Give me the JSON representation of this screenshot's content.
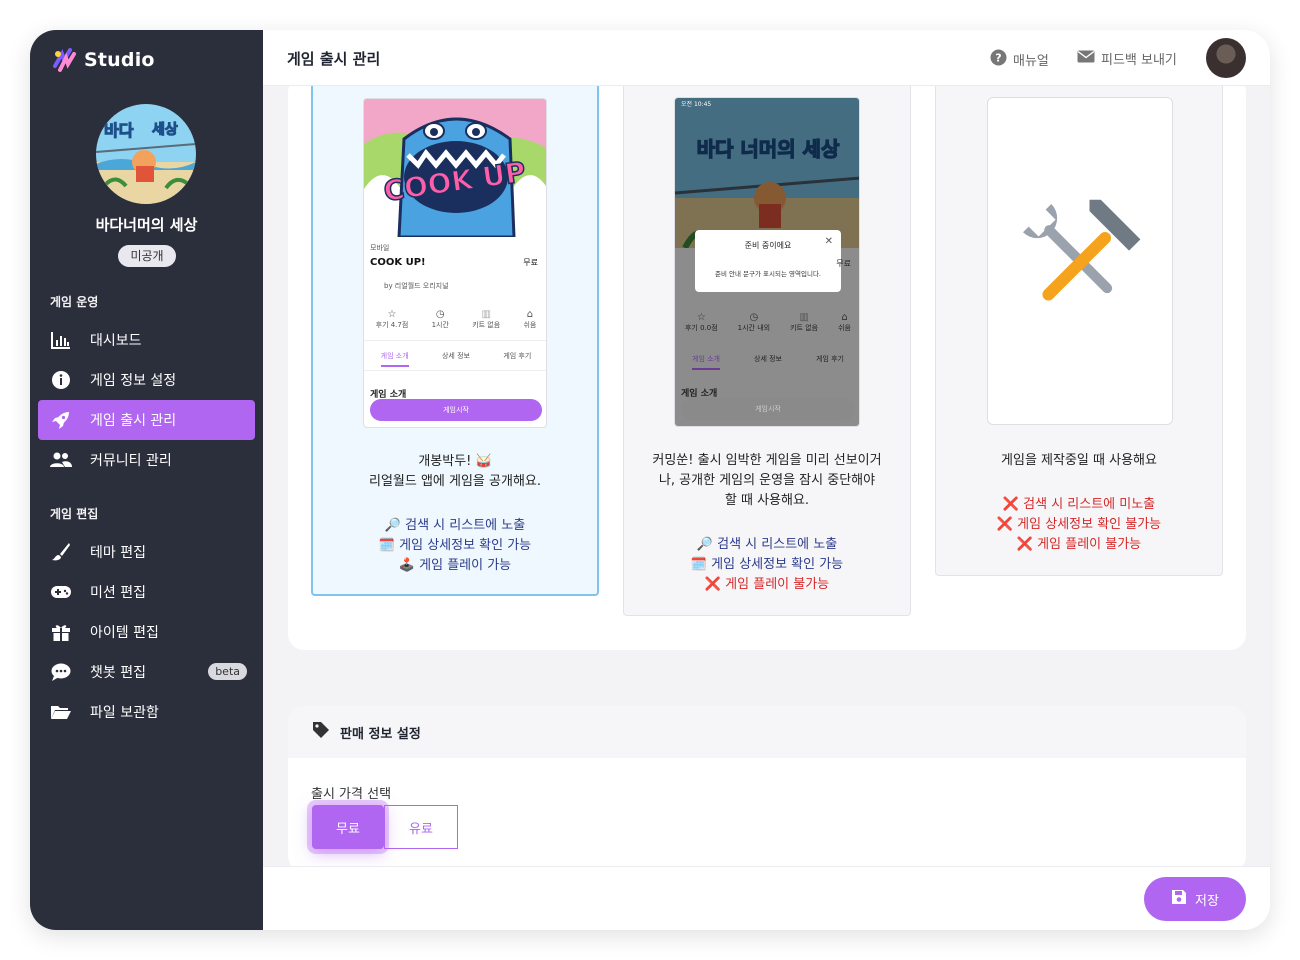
{
  "app": {
    "name": "Studio"
  },
  "sidebar": {
    "game_name": "바다너머의 세상",
    "status": "미공개",
    "sections": {
      "operation": "게임 운영",
      "editing": "게임 편집"
    },
    "items": [
      {
        "label": "대시보드",
        "icon": "bar-chart-icon"
      },
      {
        "label": "게임 정보 설정",
        "icon": "info-icon"
      },
      {
        "label": "게임 출시 관리",
        "icon": "rocket-icon",
        "active": true
      },
      {
        "label": "커뮤니티 관리",
        "icon": "users-icon"
      },
      {
        "label": "테마 편집",
        "icon": "brush-icon"
      },
      {
        "label": "미션 편집",
        "icon": "gamepad-icon"
      },
      {
        "label": "아이템 편집",
        "icon": "gift-icon"
      },
      {
        "label": "챗봇 편집",
        "icon": "chat-icon",
        "badge": "beta"
      },
      {
        "label": "파일 보관함",
        "icon": "folder-icon"
      }
    ]
  },
  "header": {
    "title": "게임 출시 관리",
    "manual": "매뉴얼",
    "feedback": "피드백 보내기"
  },
  "options": [
    {
      "phone": {
        "category": "모바일",
        "title": "COOK UP!",
        "price": "무료",
        "by": "by 리얼월드 오리지널",
        "stats": [
          "후기 4.7점",
          "1시간",
          "키트 없음",
          "쉬움"
        ],
        "tabs": [
          "게임 소개",
          "상세 정보",
          "게임 후기"
        ],
        "section": "게임 소개",
        "start": "게임시작",
        "cover_text": "COOK UP"
      },
      "desc": [
        "개봉박두! 🥁",
        "리얼월드 앱에 게임을 공개해요."
      ],
      "features": [
        {
          "text": "🔎 검색 시 리스트에 노출",
          "ok": true
        },
        {
          "text": "🗓️ 게임 상세정보 확인 가능",
          "ok": true
        },
        {
          "text": "🕹️ 게임 플레이 가능",
          "ok": true
        }
      ]
    },
    {
      "phone": {
        "statusbar": "오전 10:45",
        "modal_title": "준비 중이에요",
        "modal_body": "준비 안내 문구가 표시되는 영역입니다.",
        "price": "무료",
        "stats": [
          "후기 0.0점",
          "1시간 내외",
          "키트 없음",
          "쉬움"
        ],
        "tabs": [
          "게임 소개",
          "상세 정보",
          "게임 후기"
        ],
        "section": "게임 소개",
        "start": "게임시작",
        "cover_text": "바다 너머의 세상"
      },
      "desc": [
        "커밍쑨! 출시 임박한 게임을 미리 선보이거",
        "나, 공개한 게임의 운영을 잠시 중단해야",
        "할 때 사용해요."
      ],
      "features": [
        {
          "text": "🔎 검색 시 리스트에 노출",
          "ok": true
        },
        {
          "text": "🗓️ 게임 상세정보 확인 가능",
          "ok": true
        },
        {
          "text": "❌ 게임 플레이 불가능",
          "ok": false
        }
      ]
    },
    {
      "desc": [
        "게임을 제작중일 때 사용해요"
      ],
      "features": [
        {
          "text": "❌ 검색 시 리스트에 미노출",
          "ok": false
        },
        {
          "text": "❌ 게임 상세정보 확인 불가능",
          "ok": false
        },
        {
          "text": "❌ 게임 플레이 불가능",
          "ok": false
        }
      ]
    }
  ],
  "sale": {
    "title": "판매 정보 설정",
    "price_label": "출시 가격 선택",
    "free": "무료",
    "paid": "유료",
    "selected": "무료"
  },
  "footer": {
    "save": "저장"
  },
  "colors": {
    "accent": "#b066f0",
    "sidebar": "#2b2e3b",
    "selected_border": "#7ec4ec",
    "feature_ok": "#2c3b8c",
    "feature_no": "#d62828"
  }
}
